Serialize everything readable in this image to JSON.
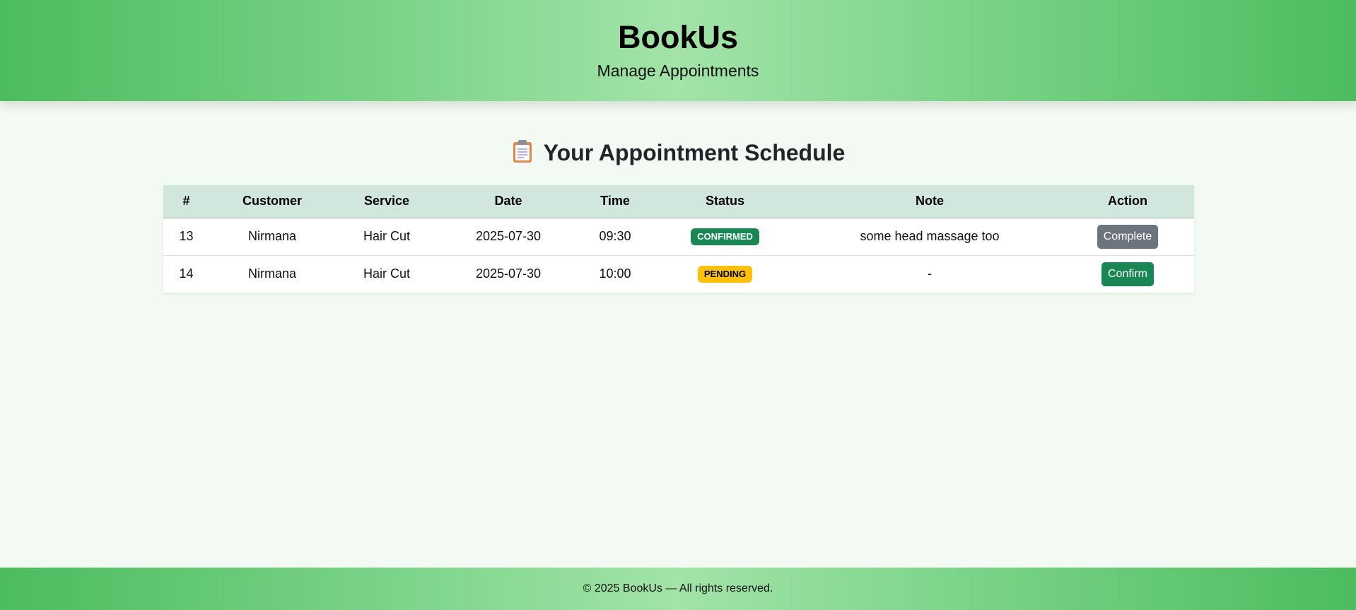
{
  "header": {
    "brand": "BookUs",
    "tagline": "Manage Appointments"
  },
  "schedule": {
    "title": "Your Appointment Schedule",
    "icon": "clipboard-icon",
    "columns": [
      "#",
      "Customer",
      "Service",
      "Date",
      "Time",
      "Status",
      "Note",
      "Action"
    ],
    "rows": [
      {
        "id": "13",
        "customer": "Nirmana",
        "service": "Hair Cut",
        "date": "2025-07-30",
        "time": "09:30",
        "status": "CONFIRMED",
        "note": "some head massage too",
        "action": "Complete"
      },
      {
        "id": "14",
        "customer": "Nirmana",
        "service": "Hair Cut",
        "date": "2025-07-30",
        "time": "10:00",
        "status": "PENDING",
        "note": "-",
        "action": "Confirm"
      }
    ]
  },
  "footer": {
    "text": "© 2025 BookUs — All rights reserved."
  },
  "colors": {
    "header_green": "#4cbc5e",
    "table_head": "#d1e7dd",
    "confirmed_badge": "#198754",
    "pending_badge": "#ffc107",
    "complete_button": "#6c757d",
    "confirm_button": "#198754"
  }
}
